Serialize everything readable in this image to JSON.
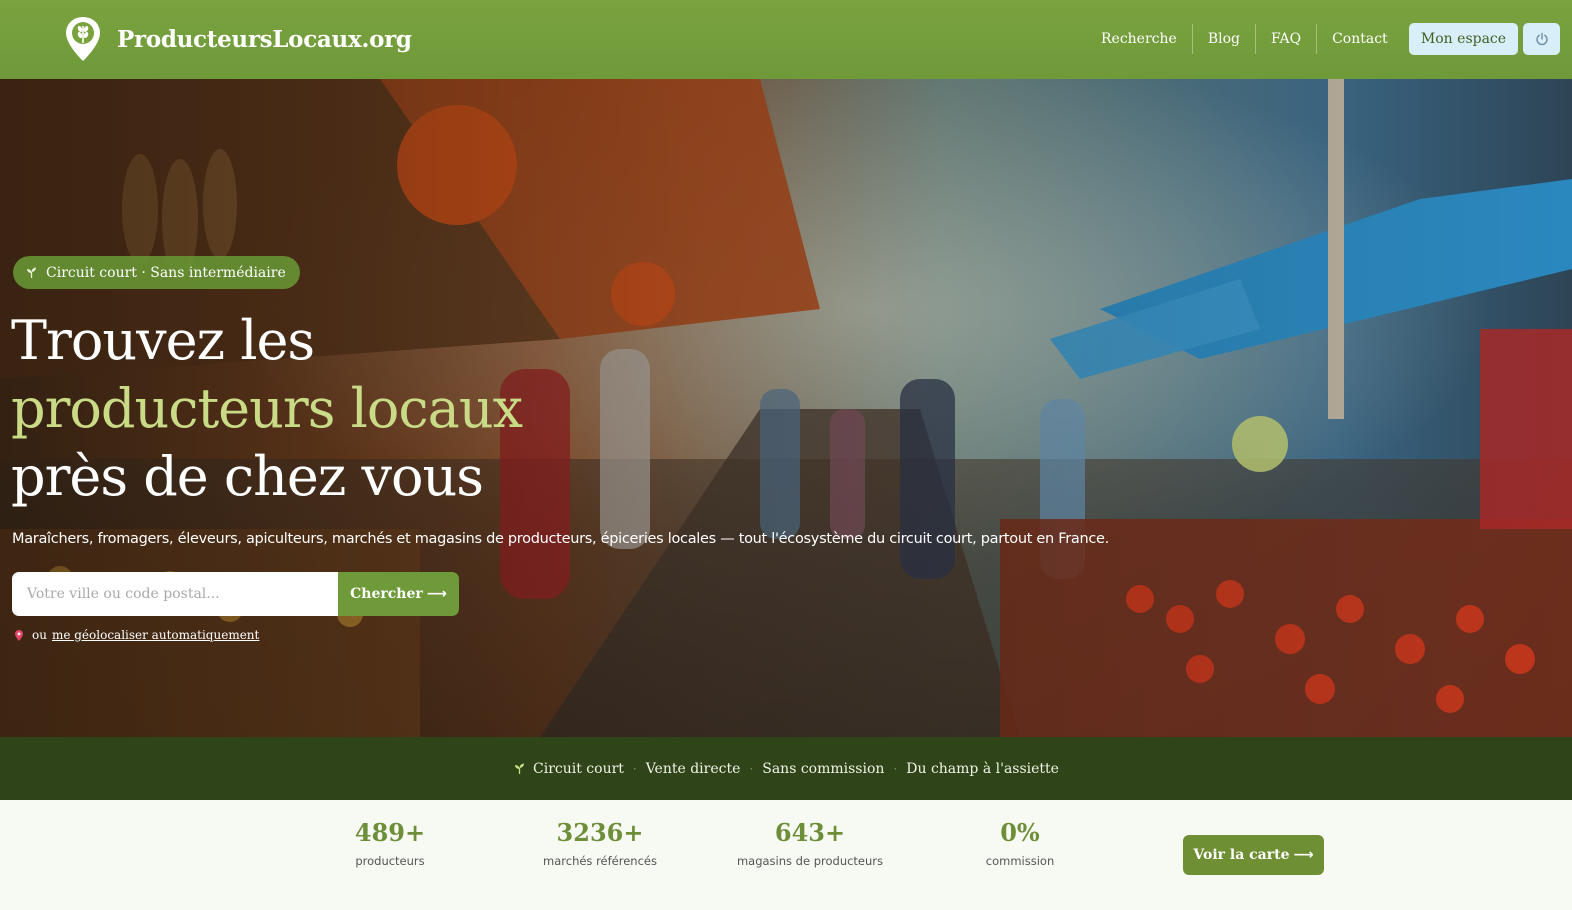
{
  "header": {
    "brand": "ProducteursLocaux.org",
    "nav": [
      "Recherche",
      "Blog",
      "FAQ",
      "Contact"
    ],
    "account_label": "Mon espace",
    "power_icon": "power-icon",
    "logo_icon": "wheat-pin-icon"
  },
  "hero": {
    "badge": "Circuit court · Sans intermédiaire",
    "title_line1": "Trouvez les",
    "title_line2": "producteurs locaux",
    "title_line3": "près de chez vous",
    "subtitle": "Maraîchers, fromagers, éleveurs, apiculteurs, marchés et magasins de producteurs, épiceries locales — tout l'écosystème du circuit court, partout en France.",
    "search_placeholder": "Votre ville ou code postal...",
    "search_button": "Chercher",
    "geo_or": "ou",
    "geo_link": "me géolocaliser automatiquement"
  },
  "ribbon": {
    "items": [
      "Circuit court",
      "Vente directe",
      "Sans commission",
      "Du champ à l'assiette"
    ]
  },
  "stats": {
    "items": [
      {
        "value": "489+",
        "label": "producteurs"
      },
      {
        "value": "3236+",
        "label": "marchés référencés"
      },
      {
        "value": "643+",
        "label": "magasins de producteurs"
      },
      {
        "value": "0%",
        "label": "commission"
      }
    ],
    "map_button": "Voir la carte"
  },
  "colors": {
    "header_green": "#7aa23f",
    "accent_title": "#c9db86",
    "ribbon_dark": "#2f4418",
    "stat_green": "#6e8f3a",
    "account_bg": "#d8eef9"
  }
}
